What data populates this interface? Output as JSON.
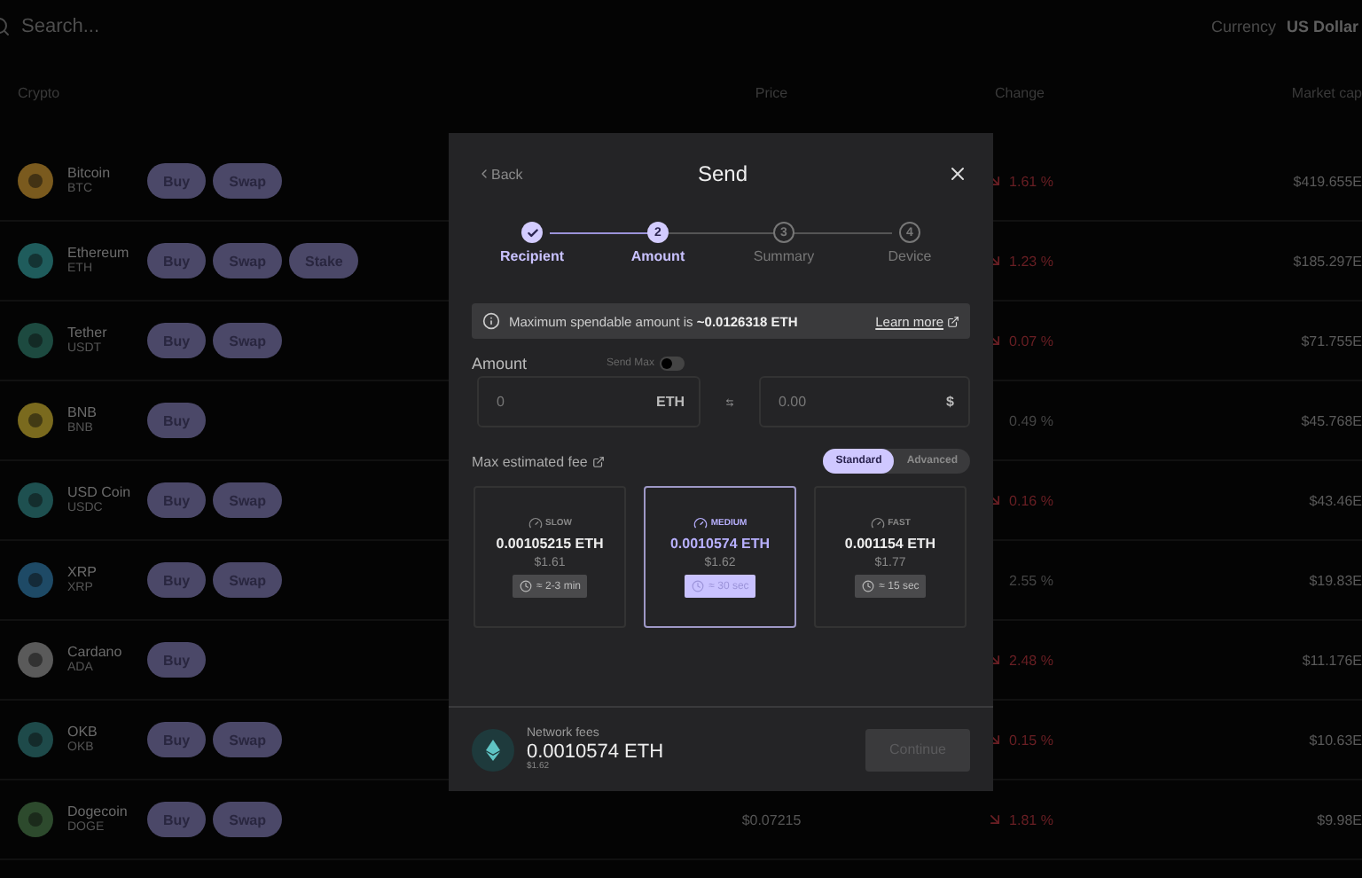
{
  "top_bar": {
    "search": {
      "placeholder": "Search..."
    },
    "currency_label": "Currency",
    "currency_value": "US Dollar"
  },
  "table": {
    "columns": [
      "Crypto",
      "Price",
      "Change",
      "Market cap"
    ],
    "rows": [
      {
        "name": "Bitcoin",
        "symbol": "BTC",
        "color": "#7a5a1e",
        "actions": [
          "Buy",
          "Swap"
        ],
        "change": "1.61 %",
        "down": true,
        "market_cap": "$419.655E"
      },
      {
        "name": "Ethereum",
        "symbol": "ETH",
        "color": "#1f5c5c",
        "actions": [
          "Buy",
          "Swap",
          "Stake"
        ],
        "change": "1.23 %",
        "down": true,
        "market_cap": "$185.297E"
      },
      {
        "name": "Tether",
        "symbol": "USDT",
        "color": "#1d4a40",
        "actions": [
          "Buy",
          "Swap"
        ],
        "change": "0.07 %",
        "down": true,
        "market_cap": "$71.755E"
      },
      {
        "name": "BNB",
        "symbol": "BNB",
        "color": "#7a6a1e",
        "actions": [
          "Buy"
        ],
        "change": "0.49 %",
        "down": false,
        "market_cap": "$45.768E"
      },
      {
        "name": "USD Coin",
        "symbol": "USDC",
        "color": "#1e5050",
        "actions": [
          "Buy",
          "Swap"
        ],
        "change": "0.16 %",
        "down": true,
        "market_cap": "$43.46E"
      },
      {
        "name": "XRP",
        "symbol": "XRP",
        "color": "#1e4a66",
        "actions": [
          "Buy",
          "Swap"
        ],
        "change": "2.55 %",
        "down": false,
        "market_cap": "$19.83E"
      },
      {
        "name": "Cardano",
        "symbol": "ADA",
        "color": "#5a5a5a",
        "actions": [
          "Buy"
        ],
        "change": "2.48 %",
        "down": true,
        "market_cap": "$11.176E"
      },
      {
        "name": "OKB",
        "symbol": "OKB",
        "color": "#1e4a4a",
        "actions": [
          "Buy",
          "Swap"
        ],
        "change": "0.15 %",
        "down": true,
        "market_cap": "$10.63E"
      },
      {
        "name": "Dogecoin",
        "symbol": "DOGE",
        "color": "#2d4a2d",
        "actions": [
          "Buy",
          "Swap"
        ],
        "price": "$0.07215",
        "change": "1.81 %",
        "down": true,
        "market_cap": "$9.98E"
      }
    ]
  },
  "modal": {
    "back": "Back",
    "title": "Send",
    "steps": [
      {
        "label": "Recipient",
        "completed": true,
        "selected": false
      },
      {
        "number": "2",
        "label": "Amount",
        "completed": false,
        "selected": true
      },
      {
        "number": "3",
        "label": "Summary",
        "completed": false,
        "selected": false
      },
      {
        "number": "4",
        "label": "Device",
        "completed": false,
        "selected": false
      }
    ],
    "notice": {
      "text": "Maximum spendable amount is **~0.0126318 ETH**",
      "link": "Learn more"
    },
    "amount": {
      "label": "Amount",
      "send_max": {
        "label": "Send Max",
        "on": false
      },
      "crypto_field": {
        "placeholder": "0",
        "unit": "ETH"
      },
      "fiat_field": {
        "placeholder": "0.00",
        "unit": "$"
      }
    },
    "fee": {
      "label": "Max estimated fee",
      "modes": [
        {
          "label": "Standard",
          "selected": true
        },
        {
          "label": "Advanced",
          "selected": false
        }
      ],
      "options": [
        {
          "speed": "SLOW",
          "amount": "0.00105215 ETH",
          "fiat": "$1.61",
          "time": "≈ 2-3 min",
          "selected": false
        },
        {
          "speed": "MEDIUM",
          "amount": "0.0010574 ETH",
          "fiat": "$1.62",
          "time": "≈ 30 sec",
          "selected": true
        },
        {
          "speed": "FAST",
          "amount": "0.001154 ETH",
          "fiat": "$1.77",
          "time": "≈ 15 sec",
          "selected": false
        }
      ]
    },
    "footer": {
      "label": "Network fees",
      "amount": "0.0010574 ETH",
      "fiat": "$1.62",
      "continue": {
        "label": "Continue",
        "disabled": true
      }
    }
  }
}
